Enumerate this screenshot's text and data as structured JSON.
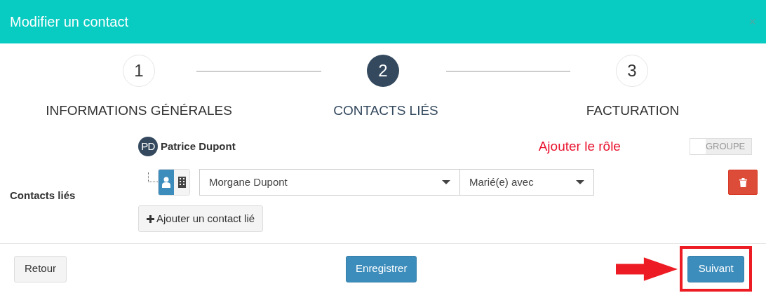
{
  "dialog": {
    "title": "Modifier un contact",
    "close": "×"
  },
  "steps": [
    {
      "number": "1",
      "label": "INFORMATIONS GÉNÉRALES",
      "selected": false
    },
    {
      "number": "2",
      "label": "CONTACTS LIÉS",
      "selected": true
    },
    {
      "number": "3",
      "label": "FACTURATION",
      "selected": false
    }
  ],
  "owner": {
    "initials": "PD",
    "name": "Patrice Dupont"
  },
  "annotation": "Ajouter le rôle",
  "group_toggle": {
    "label": "GROUPE",
    "on": false
  },
  "section_label": "Contacts liés",
  "linked_contacts": [
    {
      "type_options": [
        {
          "kind": "person",
          "selected": true
        },
        {
          "kind": "company",
          "selected": false
        }
      ],
      "contact": "Morgane Dupont",
      "role": "Marié(e) avec"
    }
  ],
  "add_button": "Ajouter un contact lié",
  "footer": {
    "back": "Retour",
    "save": "Enregistrer",
    "next": "Suivant"
  }
}
